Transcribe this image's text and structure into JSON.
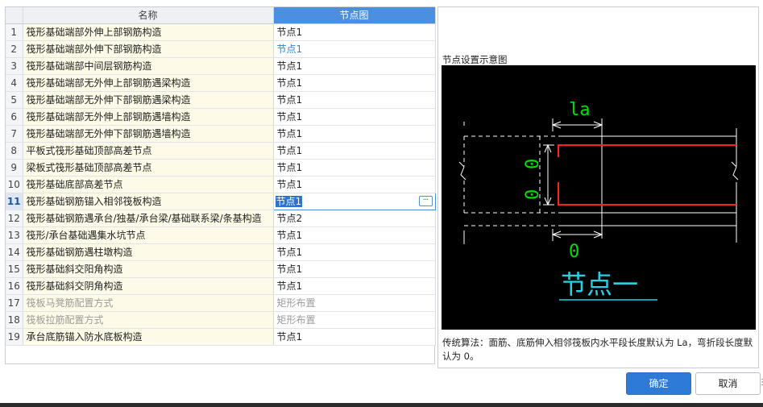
{
  "table": {
    "col_name": "名称",
    "col_node": "节点图",
    "rows": [
      {
        "idx": "1",
        "name": "筏形基础端部外伸上部钢筋构造",
        "value": "节点1",
        "state": "normal"
      },
      {
        "idx": "2",
        "name": "筏形基础端部外伸下部钢筋构造",
        "value": "节点1",
        "state": "blue"
      },
      {
        "idx": "3",
        "name": "筏形基础端部中间层钢筋构造",
        "value": "节点1",
        "state": "normal"
      },
      {
        "idx": "4",
        "name": "筏形基础端部无外伸上部钢筋遇梁构造",
        "value": "节点1",
        "state": "normal"
      },
      {
        "idx": "5",
        "name": "筏形基础端部无外伸下部钢筋遇梁构造",
        "value": "节点1",
        "state": "normal"
      },
      {
        "idx": "6",
        "name": "筏形基础端部无外伸上部钢筋遇墙构造",
        "value": "节点1",
        "state": "normal"
      },
      {
        "idx": "7",
        "name": "筏形基础端部无外伸下部钢筋遇墙构造",
        "value": "节点1",
        "state": "normal"
      },
      {
        "idx": "8",
        "name": "平板式筏形基础顶部高差节点",
        "value": "节点1",
        "state": "normal"
      },
      {
        "idx": "9",
        "name": "梁板式筏形基础顶部高差节点",
        "value": "节点1",
        "state": "normal"
      },
      {
        "idx": "10",
        "name": "筏形基础底部高差节点",
        "value": "节点1",
        "state": "normal"
      },
      {
        "idx": "11",
        "name": "筏形基础钢筋锚入相邻筏板构造",
        "value": "节点1",
        "state": "current"
      },
      {
        "idx": "12",
        "name": "筏形基础钢筋遇承台/独基/承台梁/基础联系梁/条基构造",
        "value": "节点2",
        "state": "normal"
      },
      {
        "idx": "13",
        "name": "筏形/承台基础遇集水坑节点",
        "value": "节点1",
        "state": "normal"
      },
      {
        "idx": "14",
        "name": "筏形基础钢筋遇柱墩构造",
        "value": "节点1",
        "state": "normal"
      },
      {
        "idx": "15",
        "name": "筏形基础斜交阳角构造",
        "value": "节点1",
        "state": "normal"
      },
      {
        "idx": "16",
        "name": "筏形基础斜交阴角构造",
        "value": "节点1",
        "state": "normal"
      },
      {
        "idx": "17",
        "name": "筏板马凳筋配置方式",
        "value": "矩形布置",
        "state": "disabled"
      },
      {
        "idx": "18",
        "name": "筏板拉筋配置方式",
        "value": "矩形布置",
        "state": "disabled"
      },
      {
        "idx": "19",
        "name": "承台底筋锚入防水底板构造",
        "value": "节点1",
        "state": "normal"
      }
    ]
  },
  "preview": {
    "title": "节点设置示意图",
    "diagram_labels": {
      "top_dim": "la",
      "left_dim_upper": "0",
      "left_dim_lower": "0",
      "bottom_dim": "0",
      "caption": "节点一"
    },
    "description": "传统算法：面筋、底筋伸入相邻筏板内水平段长度默认为 La，弯折段长度默认为 0。"
  },
  "buttons": {
    "ok": "确定",
    "cancel": "取消"
  },
  "icons": {
    "more": "ellipsis-icon",
    "resize": "resize-grip-icon"
  },
  "colors": {
    "accent": "#2d7bd6",
    "header_selected": "#4a8fe0",
    "name_cell_bg": "#fdfbe7",
    "rebar": "#ff2020",
    "dim": "#00e000",
    "caption": "#22d3e6"
  }
}
